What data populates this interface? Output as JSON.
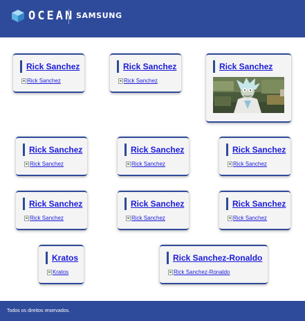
{
  "header": {
    "brand": "OCEAN",
    "partner": "SAMSUNG"
  },
  "cards": [
    {
      "title": "Rick Sanchez",
      "alt": "Rick Sanchez",
      "image_loaded": false
    },
    {
      "title": "Rick Sanchez",
      "alt": "Rick Sanchez",
      "image_loaded": false
    },
    {
      "title": "Rick Sanchez",
      "alt": "Rick Sanchez",
      "image_loaded": true
    },
    {
      "title": "Rick Sanchez",
      "alt": "Rick Sanchez",
      "image_loaded": false
    },
    {
      "title": "Rick Sanchez",
      "alt": "Rick Sanchez",
      "image_loaded": false
    },
    {
      "title": "Rick Sanchez",
      "alt": "Rick Sanchez",
      "image_loaded": false
    },
    {
      "title": "Rick Sanchez",
      "alt": "Rick Sanchez",
      "image_loaded": false
    },
    {
      "title": "Rick Sanchez",
      "alt": "Rick Sanchez",
      "image_loaded": false
    },
    {
      "title": "Rick Sanchez",
      "alt": "Rick Sanchez",
      "image_loaded": false
    },
    {
      "title": "Kratos",
      "alt": "Kratos",
      "image_loaded": false
    },
    {
      "title": "Rick Sanchez-Ronaldo",
      "alt": "Rick Sanchez-Ronaldo",
      "image_loaded": false
    }
  ],
  "footer": {
    "text": "Todos os direitos reservados."
  }
}
